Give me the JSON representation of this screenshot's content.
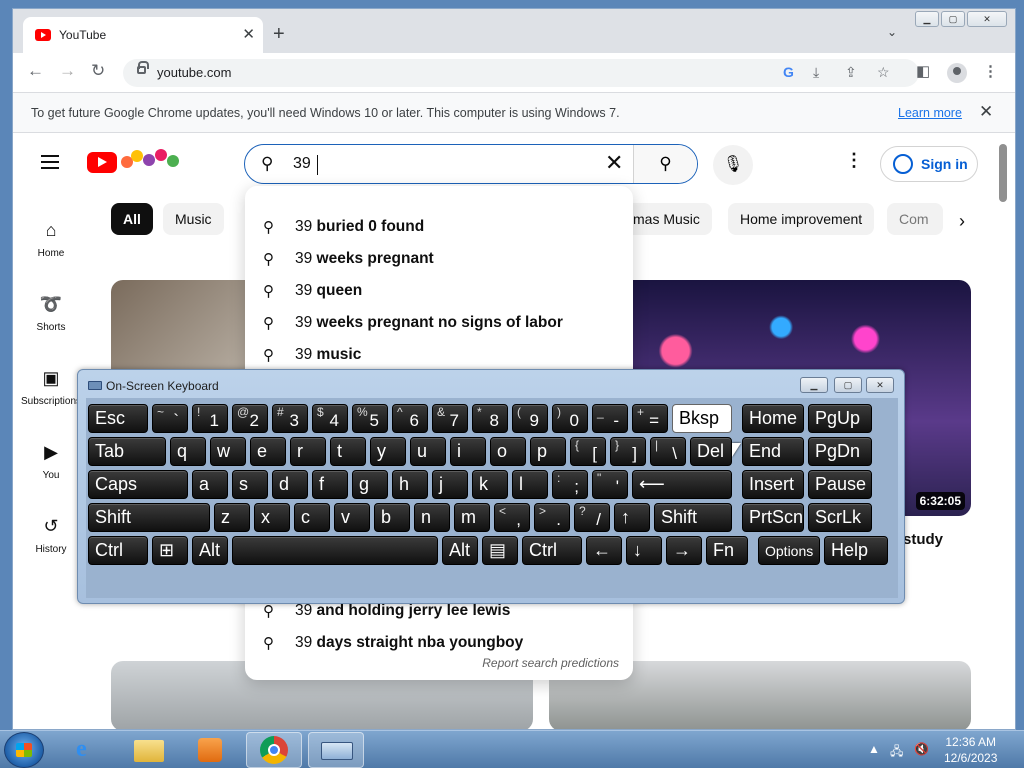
{
  "browser": {
    "tab_title": "YouTube",
    "tab_close": "✕",
    "new_tab": "+",
    "tab_search": "⌄",
    "back": "←",
    "forward": "→",
    "reload": "↻",
    "url": "youtube.com",
    "infobar_message": "To get future Google Chrome updates, you'll need Windows 10 or later. This computer is using Windows 7.",
    "infobar_link": "Learn more",
    "infobar_close": "✕"
  },
  "youtube": {
    "search_value": "39",
    "sign_in": "Sign in",
    "sidebar": [
      {
        "label": "Home",
        "icon": "⌂"
      },
      {
        "label": "Shorts",
        "icon": "➰"
      },
      {
        "label": "Subscriptions",
        "icon": "▣"
      },
      {
        "label": "You",
        "icon": "▶"
      },
      {
        "label": "History",
        "icon": "↺"
      }
    ],
    "chips": [
      "All",
      "Music",
      "mas Music",
      "Home improvement",
      "Com"
    ],
    "suggestions": [
      {
        "prefix": "39",
        "rest": " buried 0 found"
      },
      {
        "prefix": "39",
        "rest": " weeks pregnant"
      },
      {
        "prefix": "39",
        "rest": " queen"
      },
      {
        "prefix": "39",
        "rest": " weeks pregnant no signs of labor"
      },
      {
        "prefix": "39",
        "rest": " music"
      },
      {
        "prefix": "39",
        "rest": " and holding jerry lee lewis"
      },
      {
        "prefix": "39",
        "rest": " days straight nba youngboy"
      }
    ],
    "report": "Report search predictions",
    "video_duration": "6:32:05",
    "video_title_fragment": "study"
  },
  "osk": {
    "title": "On-Screen Keyboard",
    "rows": [
      [
        {
          "main": "Esc",
          "w": 60
        },
        {
          "up": "~",
          "low": "`",
          "w": 36
        },
        {
          "up": "!",
          "low": "1",
          "w": 36
        },
        {
          "up": "@",
          "low": "2",
          "w": 36
        },
        {
          "up": "#",
          "low": "3",
          "w": 36
        },
        {
          "up": "$",
          "low": "4",
          "w": 36
        },
        {
          "up": "%",
          "low": "5",
          "w": 36
        },
        {
          "up": "^",
          "low": "6",
          "w": 36
        },
        {
          "up": "&",
          "low": "7",
          "w": 36
        },
        {
          "up": "*",
          "low": "8",
          "w": 36
        },
        {
          "up": "(",
          "low": "9",
          "w": 36
        },
        {
          "up": ")",
          "low": "0",
          "w": 36
        },
        {
          "up": "_",
          "low": "-",
          "w": 36
        },
        {
          "up": "+",
          "low": "=",
          "w": 36
        },
        {
          "main": "Bksp",
          "w": 60,
          "hl": true
        },
        {
          "main": "Home",
          "w": 62,
          "gap": 6
        },
        {
          "main": "PgUp",
          "w": 64
        }
      ],
      [
        {
          "main": "Tab",
          "w": 78
        },
        {
          "main": "q",
          "w": 36
        },
        {
          "main": "w",
          "w": 36
        },
        {
          "main": "e",
          "w": 36
        },
        {
          "main": "r",
          "w": 36
        },
        {
          "main": "t",
          "w": 36
        },
        {
          "main": "y",
          "w": 36
        },
        {
          "main": "u",
          "w": 36
        },
        {
          "main": "i",
          "w": 36
        },
        {
          "main": "o",
          "w": 36
        },
        {
          "main": "p",
          "w": 36
        },
        {
          "up": "{",
          "low": "[",
          "w": 36
        },
        {
          "up": "}",
          "low": "]",
          "w": 36
        },
        {
          "up": "|",
          "low": "\\",
          "w": 36
        },
        {
          "main": "Del",
          "w": 42
        },
        {
          "main": "End",
          "w": 62,
          "gap": 6
        },
        {
          "main": "PgDn",
          "w": 64
        }
      ],
      [
        {
          "main": "Caps",
          "w": 100
        },
        {
          "main": "a",
          "w": 36
        },
        {
          "main": "s",
          "w": 36
        },
        {
          "main": "d",
          "w": 36
        },
        {
          "main": "f",
          "w": 36
        },
        {
          "main": "g",
          "w": 36
        },
        {
          "main": "h",
          "w": 36
        },
        {
          "main": "j",
          "w": 36
        },
        {
          "main": "k",
          "w": 36
        },
        {
          "main": "l",
          "w": 36
        },
        {
          "up": ":",
          "low": ";",
          "w": 36
        },
        {
          "up": "\"",
          "low": "'",
          "w": 36
        },
        {
          "main": "⟵",
          "w": 100
        },
        {
          "main": "Insert",
          "w": 62,
          "gap": 6
        },
        {
          "main": "Pause",
          "w": 64
        }
      ],
      [
        {
          "main": "Shift",
          "w": 122
        },
        {
          "main": "z",
          "w": 36
        },
        {
          "main": "x",
          "w": 36
        },
        {
          "main": "c",
          "w": 36
        },
        {
          "main": "v",
          "w": 36
        },
        {
          "main": "b",
          "w": 36
        },
        {
          "main": "n",
          "w": 36
        },
        {
          "main": "m",
          "w": 36
        },
        {
          "up": "<",
          "low": ",",
          "w": 36
        },
        {
          "up": ">",
          "low": ".",
          "w": 36
        },
        {
          "up": "?",
          "low": "/",
          "w": 36
        },
        {
          "main": "↑",
          "w": 36
        },
        {
          "main": "Shift",
          "w": 78
        },
        {
          "main": "PrtScn",
          "w": 62,
          "gap": 6
        },
        {
          "main": "ScrLk",
          "w": 64
        }
      ],
      [
        {
          "main": "Ctrl",
          "w": 60
        },
        {
          "main": "⊞",
          "w": 36
        },
        {
          "main": "Alt",
          "w": 36
        },
        {
          "main": "",
          "w": 206
        },
        {
          "main": "Alt",
          "w": 36
        },
        {
          "main": "▤",
          "w": 36
        },
        {
          "main": "Ctrl",
          "w": 60
        },
        {
          "main": "←",
          "w": 36
        },
        {
          "main": "↓",
          "w": 36
        },
        {
          "main": "→",
          "w": 36
        },
        {
          "main": "Fn",
          "w": 42
        },
        {
          "main": "Options",
          "w": 62,
          "gap": 6,
          "small": true
        },
        {
          "main": "Help",
          "w": 64
        }
      ]
    ]
  },
  "taskbar": {
    "time": "12:36 AM",
    "date": "12/6/2023"
  },
  "colors": {
    "accent": "#065fd4",
    "youtube_red": "#ff0000",
    "search_border": "#1c62b9"
  }
}
